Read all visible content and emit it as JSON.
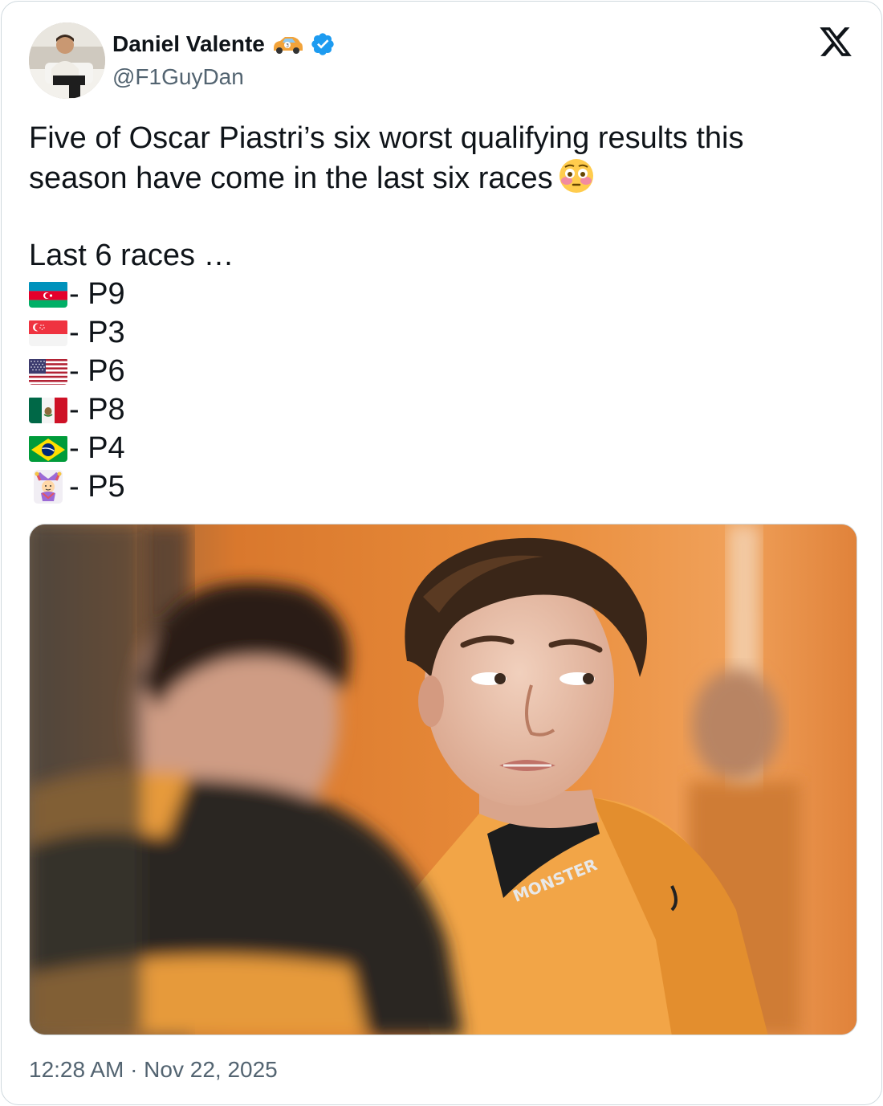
{
  "author": {
    "display_name": "Daniel Valente",
    "handle": "@F1GuyDan",
    "name_emoji": "race-car-emoji",
    "verified_color": "#1d9bf0",
    "avatar_icon": "user-avatar"
  },
  "brand": {
    "icon": "x-logo",
    "color": "#0f1419"
  },
  "tweet": {
    "line1": "Five of Oscar Piastri’s six worst qualifying results this",
    "line2": "season have come in the last six races",
    "emoji": "flushed-face-emoji",
    "intro": "Last 6 races …",
    "races": [
      {
        "flag": "azerbaijan-flag",
        "result": "- P9"
      },
      {
        "flag": "singapore-flag",
        "result": "- P3"
      },
      {
        "flag": "usa-flag",
        "result": "- P6"
      },
      {
        "flag": "mexico-flag",
        "result": "- P8"
      },
      {
        "flag": "brazil-flag",
        "result": "- P4"
      },
      {
        "flag": "jester-emoji",
        "result": " - P5"
      }
    ]
  },
  "media": {
    "icon": "tweet-photo",
    "jacket_text": "MONSTER",
    "colors": {
      "background": "#e8873a",
      "jacket": "#f2a547"
    }
  },
  "timestamp": "12:28 AM · Nov 22, 2025",
  "colors": {
    "text": "#0f1419",
    "secondary": "#536471",
    "border": "#cfd9de"
  }
}
